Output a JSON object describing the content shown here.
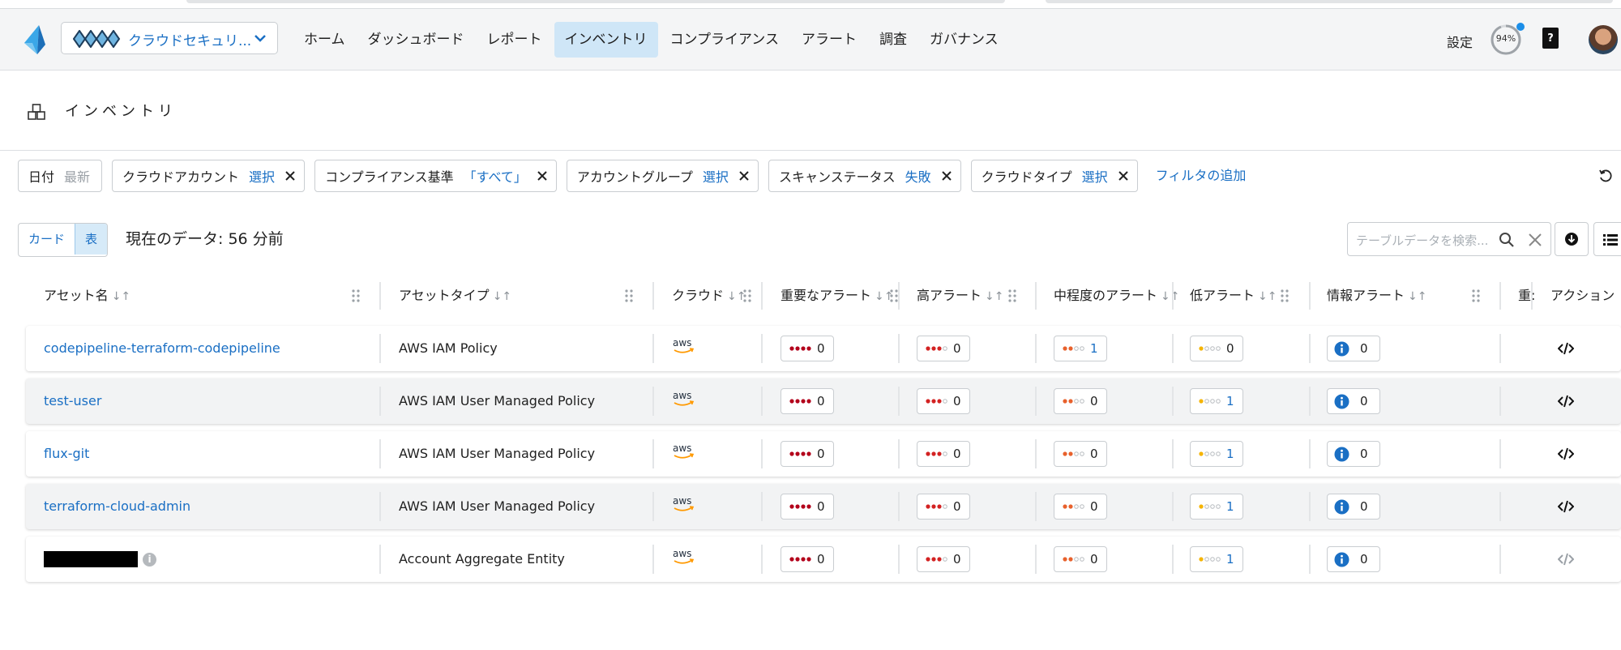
{
  "nav": {
    "tenant_name": "クラウドセキュリ...",
    "items": [
      "ホーム",
      "ダッシュボード",
      "レポート",
      "インベントリ",
      "コンプライアンス",
      "アラート",
      "調査",
      "ガバナンス"
    ],
    "active_index": 3,
    "settings_label": "設定",
    "progress_label": "94%",
    "progress_fraction": 0.94
  },
  "page": {
    "title": "インベントリ"
  },
  "filters": {
    "date": {
      "label": "日付",
      "value": "最新"
    },
    "chips": [
      {
        "label": "クラウドアカウント",
        "value": "選択"
      },
      {
        "label": "コンプライアンス基準",
        "value": "「すべて」"
      },
      {
        "label": "アカウントグループ",
        "value": "選択"
      },
      {
        "label": "スキャンステータス",
        "value": "失敗"
      },
      {
        "label": "クラウドタイプ",
        "value": "選択"
      }
    ],
    "add_label": "フィルタの追加"
  },
  "toolbar": {
    "view_card": "カード",
    "view_table": "表",
    "data_as_of": "現在のデータ: 56 分前",
    "search_placeholder": "テーブルデータを検索..."
  },
  "table": {
    "columns": {
      "asset_name": "アセット名",
      "asset_type": "アセットタイプ",
      "cloud": "クラウド",
      "critical": "重要なアラート",
      "high": "高アラート",
      "medium": "中程度のアラート",
      "low": "低アラート",
      "info": "情報アラート",
      "extra": "重:",
      "actions": "アクション"
    },
    "sort_glyph": "↓↑",
    "rows": [
      {
        "name": "codepipeline-terraform-codepipeline",
        "type": "AWS IAM Policy",
        "cloud": "aws",
        "critical": "0",
        "high": "0",
        "medium": "1",
        "low": "0",
        "info": "0"
      },
      {
        "name": "test-user",
        "type": "AWS IAM User Managed Policy",
        "cloud": "aws",
        "critical": "0",
        "high": "0",
        "medium": "0",
        "low": "1",
        "info": "0"
      },
      {
        "name": "flux-git",
        "type": "AWS IAM User Managed Policy",
        "cloud": "aws",
        "critical": "0",
        "high": "0",
        "medium": "0",
        "low": "1",
        "info": "0"
      },
      {
        "name": "terraform-cloud-admin",
        "type": "AWS IAM User Managed Policy",
        "cloud": "aws",
        "critical": "0",
        "high": "0",
        "medium": "0",
        "low": "1",
        "info": "0"
      },
      {
        "name": "",
        "type": "Account Aggregate Entity",
        "cloud": "aws",
        "critical": "0",
        "high": "0",
        "medium": "0",
        "low": "1",
        "info": "0"
      }
    ]
  },
  "colors": {
    "accent": "#1a6fc4",
    "active_nav_bg": "#cfe6f7",
    "critical": "#b3001b",
    "high": "#d32222",
    "medium": "#e8612c",
    "low": "#f5b400",
    "info": "#1a6fc4"
  }
}
